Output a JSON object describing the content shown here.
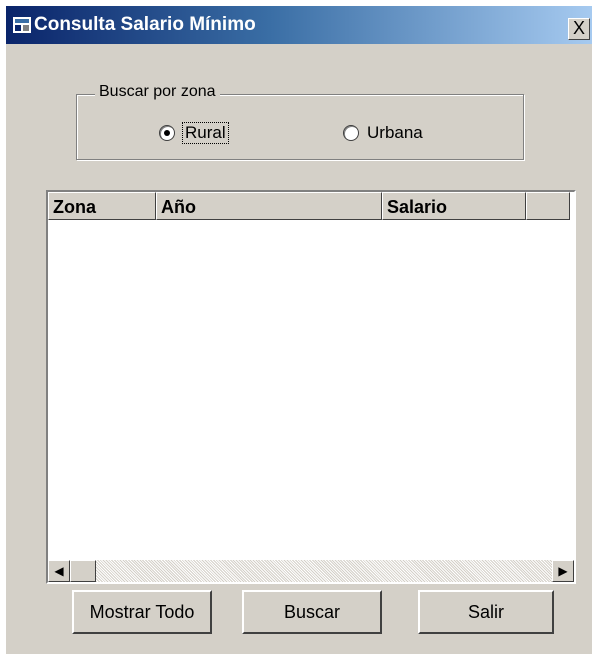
{
  "window": {
    "title": "Consulta Salario Mínimo",
    "close_symbol": "X"
  },
  "search_group": {
    "legend": "Buscar por zona",
    "options": [
      {
        "label": "Rural",
        "selected": true
      },
      {
        "label": "Urbana",
        "selected": false
      }
    ]
  },
  "table": {
    "columns": [
      "Zona",
      "Año",
      "Salario"
    ],
    "rows": []
  },
  "buttons": {
    "show_all": "Mostrar Todo",
    "search": "Buscar",
    "exit": "Salir"
  },
  "scrollbar": {
    "left_arrow": "◀",
    "right_arrow": "▶"
  }
}
